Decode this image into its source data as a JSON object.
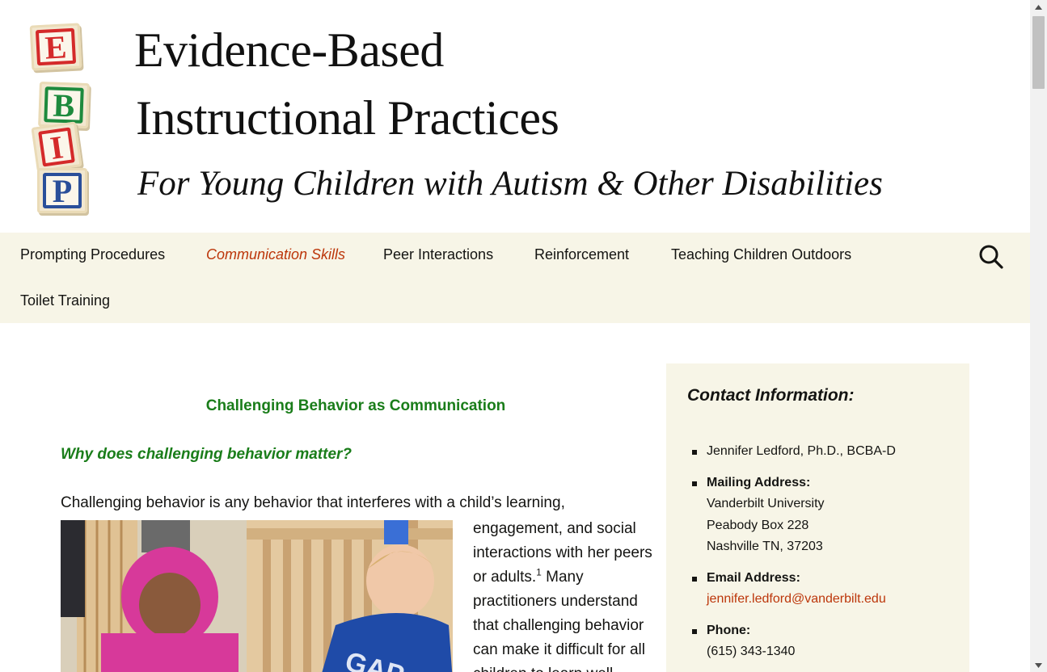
{
  "header": {
    "logo_blocks": [
      "E",
      "B",
      "I",
      "P"
    ],
    "title_line1": "Evidence-Based",
    "title_line2": "Instructional Practices",
    "subtitle": "For Young Children with Autism & Other Disabilities"
  },
  "nav": {
    "items": [
      {
        "label": "Prompting Procedures",
        "current": false
      },
      {
        "label": "Communication Skills",
        "current": true
      },
      {
        "label": "Peer Interactions",
        "current": false
      },
      {
        "label": "Reinforcement",
        "current": false
      },
      {
        "label": "Teaching Children Outdoors",
        "current": false
      },
      {
        "label": "Toilet Training",
        "current": false
      }
    ],
    "search_icon": "search-icon"
  },
  "article": {
    "title": "Challenging Behavior as Communication",
    "section_heading": "Why does challenging behavior matter?",
    "para_first_line": "Challenging behavior is any behavior that interferes with a child’s learning,",
    "para_wrapped_1": "engagement, and social interactions with her peers or adults.",
    "footnote": "1",
    "para_wrapped_2": " Many practitioners understand that challenging behavior can make it difficult for all children to learn well"
  },
  "sidebar": {
    "title": "Contact Information:",
    "name": "Jennifer Ledford, Ph.D., BCBA-D",
    "mailing_label": "Mailing Address:",
    "mailing_lines": [
      "Vanderbilt University",
      "Peabody Box 228",
      "Nashville TN, 37203"
    ],
    "email_label": "Email Address:",
    "email": "jennifer.ledford@vanderbilt.edu",
    "phone_label": "Phone:",
    "phone": "(615) 343-1340"
  },
  "colors": {
    "accent": "#bc360a",
    "heading_green": "#1a7d1a",
    "nav_bg": "#f7f5e7"
  }
}
